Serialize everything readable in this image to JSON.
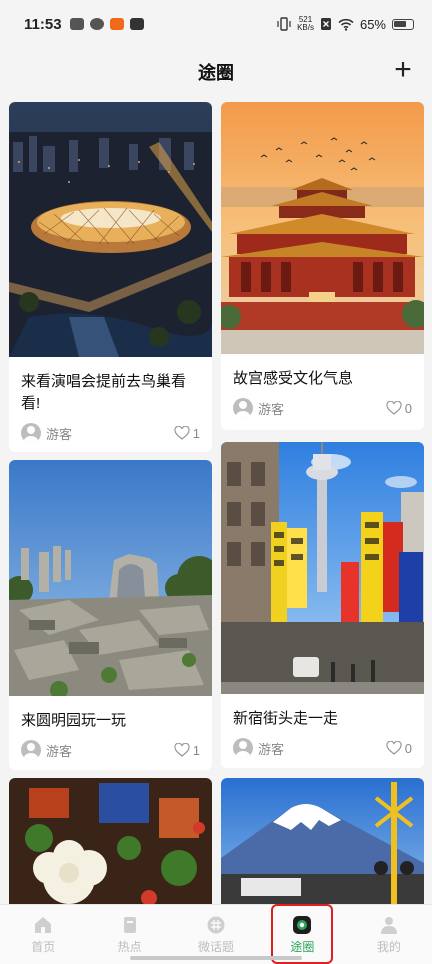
{
  "status_bar": {
    "time": "11:53",
    "net_speed_value": "521",
    "net_speed_unit": "KB/s",
    "battery": "65%"
  },
  "header": {
    "title": "途圈",
    "add_label": "+"
  },
  "posts": [
    {
      "title": "来看演唱会提前去鸟巢看看!",
      "author": "游客",
      "likes": "1"
    },
    {
      "title": "故宫感受文化气息",
      "author": "游客",
      "likes": "0"
    },
    {
      "title": "来圆明园玩一玩",
      "author": "游客",
      "likes": "1"
    },
    {
      "title": "新宿街头走一走",
      "author": "游客",
      "likes": "0"
    }
  ],
  "nav": {
    "items": [
      {
        "label": "首页",
        "icon": "home-icon"
      },
      {
        "label": "热点",
        "icon": "hot-icon"
      },
      {
        "label": "微话题",
        "icon": "topic-icon"
      },
      {
        "label": "途圈",
        "icon": "circle-icon"
      },
      {
        "label": "我的",
        "icon": "profile-icon"
      }
    ],
    "active_index": 3
  },
  "colors": {
    "accent": "#2aa45a",
    "highlight_box": "#e02020",
    "inactive": "#bdbdbd"
  }
}
